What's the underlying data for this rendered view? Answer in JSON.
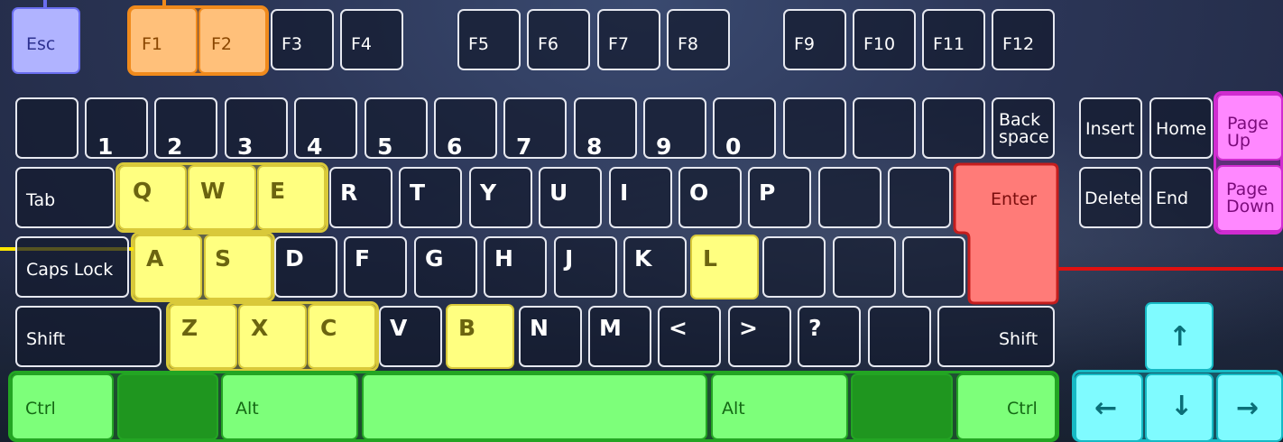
{
  "colors": {
    "esc_group": "#b0b3ff",
    "function_group": "#ffc07a",
    "movement_group": "#ffff80",
    "page_group": "#ff88ff",
    "enter_group": "#ff7b78",
    "modifier_group": "#7dff7a",
    "arrow_group": "#7ffbff",
    "unassigned_key": "#1a2038"
  },
  "keys": {
    "esc": "Esc",
    "f1": "F1",
    "f2": "F2",
    "f3": "F3",
    "f4": "F4",
    "f5": "F5",
    "f6": "F6",
    "f7": "F7",
    "f8": "F8",
    "f9": "F9",
    "f10": "F10",
    "f11": "F11",
    "f12": "F12",
    "d1": "1",
    "d2": "2",
    "d3": "3",
    "d4": "4",
    "d5": "5",
    "d6": "6",
    "d7": "7",
    "d8": "8",
    "d9": "9",
    "d0": "0",
    "backspace": "Back\nspace",
    "insert": "Insert",
    "home": "Home",
    "page_up": "Page\nUp",
    "tab": "Tab",
    "q": "Q",
    "w": "W",
    "e": "E",
    "r": "R",
    "t": "T",
    "y": "Y",
    "u": "U",
    "i": "I",
    "o": "O",
    "p": "P",
    "enter": "Enter",
    "delete": "Delete",
    "end": "End",
    "page_down": "Page\nDown",
    "caps_lock": "Caps Lock",
    "a": "A",
    "s": "S",
    "d": "D",
    "f": "F",
    "g": "G",
    "h": "H",
    "j": "J",
    "k": "K",
    "l": "L",
    "shift_left": "Shift",
    "z": "Z",
    "x": "X",
    "c": "C",
    "v": "V",
    "b": "B",
    "n": "N",
    "m": "M",
    "lt": "<",
    "gt": ">",
    "question": "?",
    "shift_right": "Shift",
    "ctrl_left": "Ctrl",
    "alt_left": "Alt",
    "alt_right": "Alt",
    "ctrl_right": "Ctrl",
    "arrow_up": "up-arrow-icon",
    "arrow_left": "left-arrow-icon",
    "arrow_down": "down-arrow-icon",
    "arrow_right": "right-arrow-icon"
  }
}
